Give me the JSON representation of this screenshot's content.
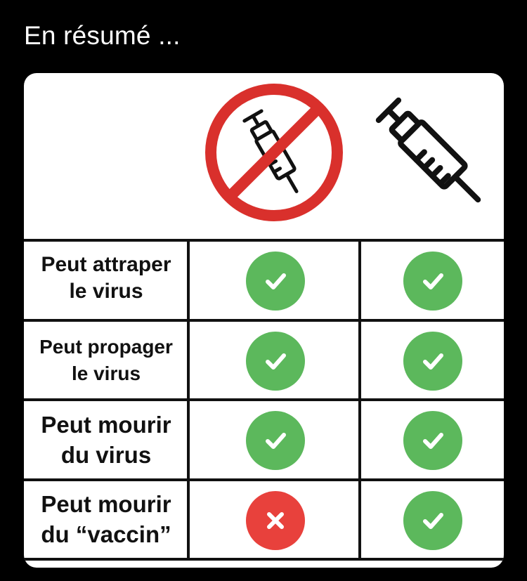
{
  "post": {
    "text": "En résumé ..."
  },
  "table": {
    "columns": [
      {
        "icon": "no-syringe-icon",
        "meaning": "non-vaccinated"
      },
      {
        "icon": "syringe-icon",
        "meaning": "vaccinated"
      }
    ],
    "rows": [
      {
        "label_line1": "Peut attraper",
        "label_line2": "le virus",
        "values": [
          "check",
          "check"
        ]
      },
      {
        "label_line1": "Peut propager",
        "label_line2": "le virus",
        "values": [
          "check",
          "check"
        ]
      },
      {
        "label_line1": "Peut mourir",
        "label_line2": "du virus",
        "values": [
          "check",
          "check"
        ]
      },
      {
        "label_line1": "Peut mourir",
        "label_line2": "du “vaccin”",
        "values": [
          "cross",
          "check"
        ]
      }
    ]
  },
  "colors": {
    "check_green": "#5cb85c",
    "cross_red": "#e8413c",
    "prohibition_red": "#d9302c",
    "background": "#000000",
    "card": "#ffffff"
  }
}
